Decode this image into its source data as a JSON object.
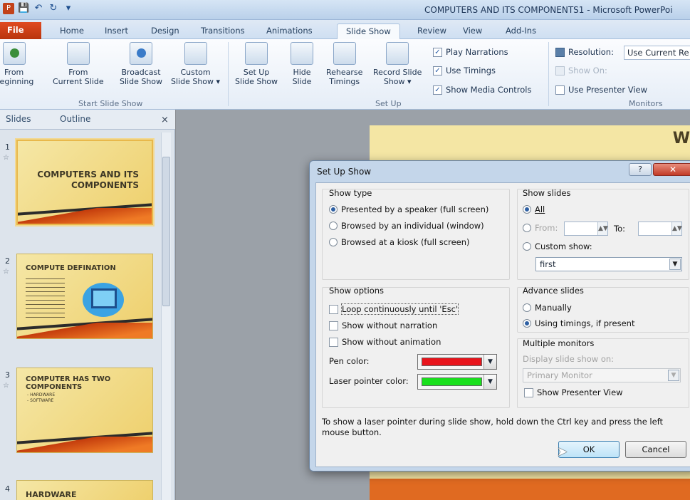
{
  "window": {
    "title": "COMPUTERS AND ITS COMPONENTS1 - Microsoft PowerPoi"
  },
  "qat": {
    "save_icon": "save-icon",
    "undo_icon": "undo-icon",
    "redo_icon": "redo-icon",
    "customize": "▾"
  },
  "tabs": [
    "File",
    "Home",
    "Insert",
    "Design",
    "Transitions",
    "Animations",
    "Slide Show",
    "Review",
    "View",
    "Add-Ins"
  ],
  "ribbon": {
    "start": {
      "from_beginning": [
        "From",
        "Beginning"
      ],
      "from_current": [
        "From",
        "Current Slide"
      ],
      "broadcast": [
        "Broadcast",
        "Slide Show"
      ],
      "custom": [
        "Custom",
        "Slide Show ▾"
      ],
      "group_label": "Start Slide Show"
    },
    "setup": {
      "setup_show": [
        "Set Up",
        "Slide Show"
      ],
      "hide_slide": [
        "Hide",
        "Slide"
      ],
      "rehearse": [
        "Rehearse",
        "Timings"
      ],
      "record": [
        "Record Slide",
        "Show ▾"
      ],
      "play_narrations": "Play Narrations",
      "use_timings": "Use Timings",
      "show_media": "Show Media Controls",
      "group_label": "Set Up"
    },
    "monitors": {
      "resolution_label": "Resolution:",
      "resolution_value": "Use Current Re",
      "show_on": "Show On:",
      "presenter_view": "Use Presenter View",
      "group_label": "Monitors"
    }
  },
  "panel": {
    "tab_slides": "Slides",
    "tab_outline": "Outline",
    "close": "×",
    "slides": [
      {
        "num": "1",
        "title": "COMPUTERS AND ITS\nCOMPONENTS"
      },
      {
        "num": "2",
        "title": "COMPUTE DEFINATION"
      },
      {
        "num": "3",
        "title": "COMPUTER HAS TWO\nCOMPONENTS",
        "bullets": "- HARDWARE\n- SOFTWARE"
      },
      {
        "num": "4",
        "title": "HARDWARE"
      }
    ]
  },
  "slide_canvas": {
    "heading_fragment": "W"
  },
  "dialog": {
    "title": "Set Up Show",
    "help": "?",
    "close": "✕",
    "show_type": {
      "label": "Show type",
      "presented": "Presented by a speaker (full screen)",
      "browsed_individual": "Browsed by an individual (window)",
      "browsed_kiosk": "Browsed at a kiosk (full screen)"
    },
    "show_slides": {
      "label": "Show slides",
      "all": "All",
      "from": "From:",
      "to": "To:",
      "custom_show": "Custom show:",
      "custom_value": "first"
    },
    "show_options": {
      "label": "Show options",
      "loop": "Loop continuously until 'Esc'",
      "without_narration": "Show without narration",
      "without_animation": "Show without animation",
      "pen_color": "Pen color:",
      "laser_color": "Laser pointer color:",
      "pen_hex": "#e8141c",
      "laser_hex": "#19e01c"
    },
    "advance_slides": {
      "label": "Advance slides",
      "manually": "Manually",
      "using_timings": "Using timings, if present"
    },
    "multiple_monitors": {
      "label": "Multiple monitors",
      "display_on": "Display slide show on:",
      "monitor_value": "Primary Monitor",
      "presenter_view": "Show Presenter View"
    },
    "note": "To show a laser pointer during slide show, hold down the Ctrl key and press the left mouse button.",
    "ok": "OK",
    "cancel": "Cancel"
  }
}
